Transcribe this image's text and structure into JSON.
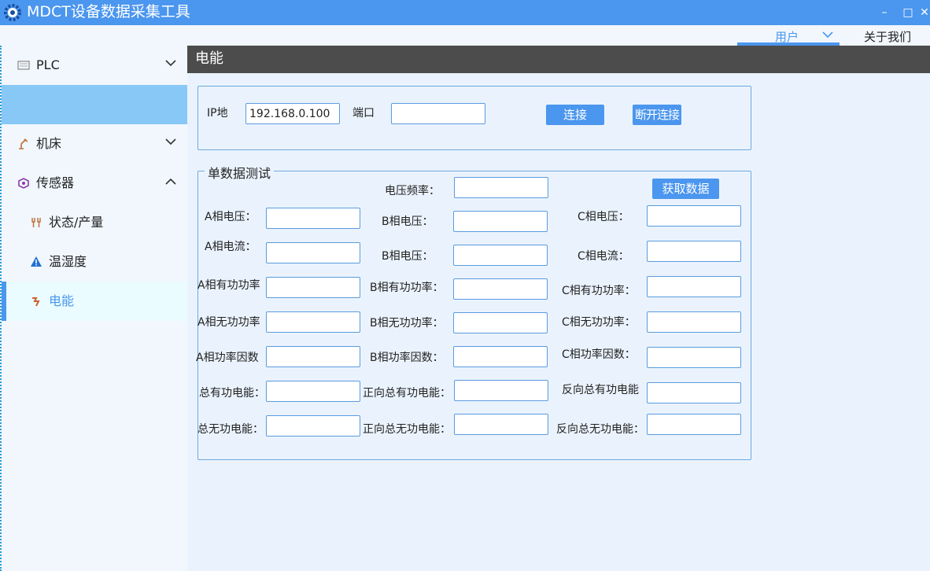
{
  "window": {
    "title": "MDCT设备数据采集工具",
    "minimize_glyph": "–",
    "maximize_glyph": "□",
    "close_glyph": "✕",
    "icon": "gear-icon"
  },
  "menubar": {
    "user": "用户",
    "about": "关于我们"
  },
  "sidebar": {
    "items": [
      {
        "label": "PLC",
        "icon": "plc-icon",
        "expanded": false
      },
      {
        "label": "机床",
        "icon": "machine-tool-icon",
        "expanded": false
      },
      {
        "label": "传感器",
        "icon": "sensor-icon",
        "expanded": true
      },
      {
        "label": "状态/产量",
        "icon": "status-icon"
      },
      {
        "label": "温湿度",
        "icon": "warning-triangle-icon"
      },
      {
        "label": "电能",
        "icon": "energy-icon",
        "selected": true
      }
    ]
  },
  "content": {
    "title": "电能",
    "connection": {
      "ip_label": "IP地",
      "ip_value": "192.168.0.100",
      "port_label": "端口",
      "port_value": "",
      "connect_button": "连接",
      "disconnect_button": "断开连接"
    },
    "single": {
      "legend": "单数据测试",
      "voltage_freq_label": "电压频率：",
      "fetch_button": "获取数据",
      "rows": [
        {
          "a": "A相电压：",
          "b": "B相电压：",
          "c": "C相电压："
        },
        {
          "a": "A相电流：",
          "b": "B相电压：",
          "c": "C相电流："
        },
        {
          "a": "A相有功功率",
          "b": "B相有功功率：",
          "c": "C相有功功率："
        },
        {
          "a": "A相无功功率",
          "b": "B相无功功率：",
          "c": "C相无功功率："
        },
        {
          "a": "A相功率因数",
          "b": "B相功率因数：",
          "c": "C相功率因数："
        },
        {
          "a": "总有功电能：",
          "b": "正向总有功电能：",
          "c": "反向总有功电能"
        },
        {
          "a": "总无功电能：",
          "b": "正向总无功电能：",
          "c": "反向总无功电能："
        }
      ]
    }
  },
  "colors": {
    "accent": "#4b96ee",
    "selected_bg": "#87c8f7",
    "header_bg": "#4c4c4c"
  }
}
